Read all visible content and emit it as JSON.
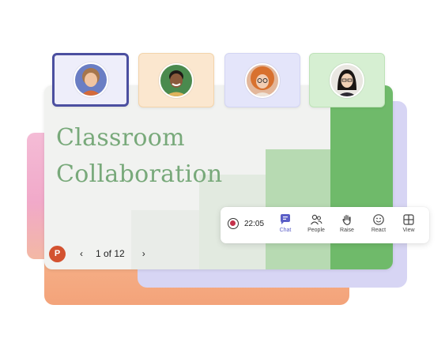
{
  "slide": {
    "title_line1": "Classroom",
    "title_line2": "Collaboration"
  },
  "pager": {
    "app_icon_letter": "P",
    "prev": "‹",
    "page_counter": "1 of 12",
    "next": "›"
  },
  "participants": [
    {
      "name": "participant-1",
      "tile_color": "#eeeefa",
      "selected": true
    },
    {
      "name": "participant-2",
      "tile_color": "#fbe7cf",
      "selected": false
    },
    {
      "name": "participant-3",
      "tile_color": "#e4e5fa",
      "selected": false
    },
    {
      "name": "participant-4",
      "tile_color": "#d6efd2",
      "selected": false
    }
  ],
  "toolbar": {
    "timer": "22:05",
    "chat_label": "Chat",
    "people_label": "People",
    "raise_label": "Raise",
    "react_label": "React",
    "view_label": "View"
  },
  "colors": {
    "accent": "#5b5fc7",
    "selected_border": "#4b4fa0",
    "title_green": "#78a97a",
    "record_red": "#c4314b",
    "powerpoint": "#d35230"
  },
  "icons": [
    "record-icon",
    "chat-icon",
    "people-icon",
    "raise-hand-icon",
    "react-icon",
    "view-icon",
    "powerpoint-icon",
    "chevron-left-icon",
    "chevron-right-icon"
  ]
}
